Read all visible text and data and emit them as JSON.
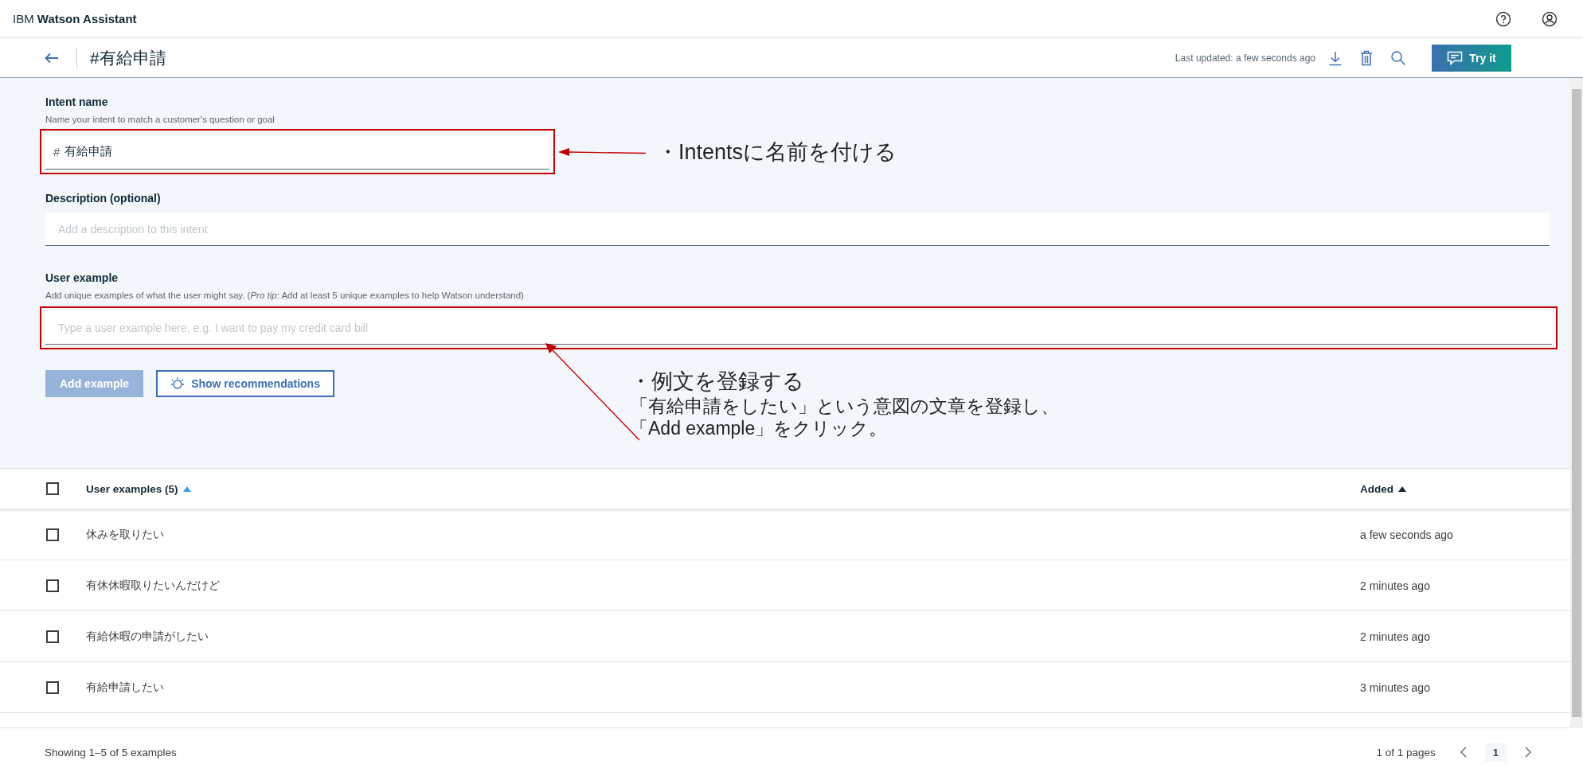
{
  "app_bar": {
    "brand_prefix": "IBM",
    "brand_name": "Watson Assistant"
  },
  "header": {
    "title": "#有給申請",
    "last_updated": "Last updated: a few seconds ago",
    "try_button": "Try it"
  },
  "form": {
    "intent_label": "Intent name",
    "intent_helper": "Name your intent to match a customer's question or goal",
    "intent_prefix": "#",
    "intent_value": "有給申請",
    "description_label": "Description (optional)",
    "description_placeholder": "Add a description to this intent",
    "example_label": "User example",
    "example_helper": "Add unique examples of what the user might say. (*Pro tip*: Add at least 5 unique examples to help Watson understand)",
    "example_placeholder": "Type a user example here, e.g. I want to pay my credit card bill",
    "add_button": {
      "label": "Add example",
      "disabled": true
    },
    "recommend_button": "Show recommendations"
  },
  "annotations": [
    {
      "lines": [
        "・Intentsに名前を付ける"
      ]
    },
    {
      "lines": [
        "・例文を登録する",
        "「有給申請をしたい」という意図の文章を登録し、",
        "「Add example」をクリック。"
      ]
    }
  ],
  "table": {
    "select_all": {
      "checked": false
    },
    "columns": [
      {
        "label": "User examples (5)",
        "sorted": true
      },
      {
        "label": "Added",
        "sorted": false
      }
    ],
    "rows": [
      {
        "checked": false,
        "text": "休みを取りたい",
        "added": "a few seconds ago"
      },
      {
        "checked": false,
        "text": "有休休暇取りたいんだけど",
        "added": "2 minutes ago"
      },
      {
        "checked": false,
        "text": "有給休暇の申請がしたい",
        "added": "2 minutes ago"
      },
      {
        "checked": false,
        "text": "有給申請したい",
        "added": "3 minutes ago"
      }
    ]
  },
  "footer": {
    "showing": "Showing 1–5 of 5 examples",
    "pages": "1 of 1 pages",
    "page_buttons": [
      {
        "label": "1",
        "selected": true
      }
    ]
  }
}
